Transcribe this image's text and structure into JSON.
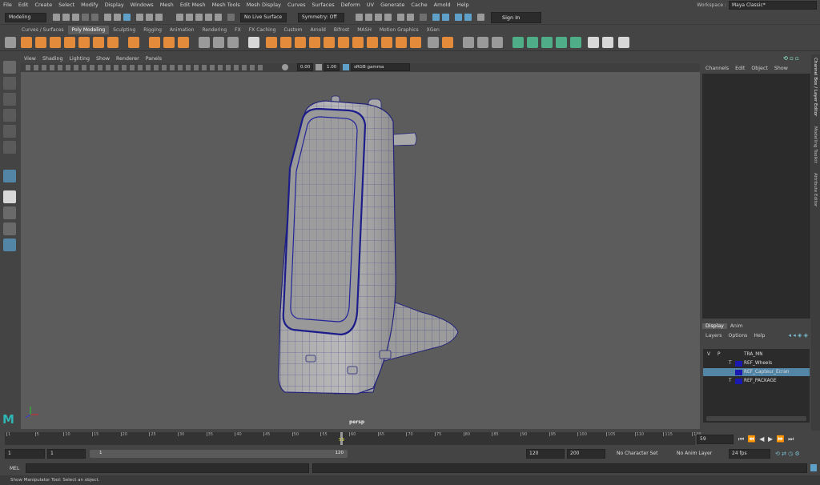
{
  "menubar": {
    "items": [
      "File",
      "Edit",
      "Create",
      "Select",
      "Modify",
      "Display",
      "Windows",
      "Mesh",
      "Edit Mesh",
      "Mesh Tools",
      "Mesh Display",
      "Curves",
      "Surfaces",
      "Deform",
      "UV",
      "Generate",
      "Cache",
      "Arnold",
      "Help"
    ],
    "workspace_label": "Workspace :",
    "workspace_value": "Maya Classic*"
  },
  "statusline": {
    "mode": "Modeling",
    "live_surface": "No Live Surface",
    "symmetry": "Symmetry: Off",
    "sign_in": "Sign In"
  },
  "shelf": {
    "tabs": [
      "Curves / Surfaces",
      "Poly Modeling",
      "Sculpting",
      "Rigging",
      "Animation",
      "Rendering",
      "FX",
      "FX Caching",
      "Custom",
      "Arnold",
      "Bifrost",
      "MASH",
      "Motion Graphics",
      "XGen"
    ],
    "active_tab": "Poly Modeling"
  },
  "viewport": {
    "menu": [
      "View",
      "Shading",
      "Lighting",
      "Show",
      "Renderer",
      "Panels"
    ],
    "exposure": "0.00",
    "gamma": "1.00",
    "color_space": "sRGB gamma",
    "camera": "persp"
  },
  "channelbox": {
    "menu": [
      "Channels",
      "Edit",
      "Object",
      "Show"
    ]
  },
  "side_tabs": [
    "Channel Box / Layer Editor",
    "Modelling Toolkit",
    "Attribute Editor"
  ],
  "layer_editor": {
    "tabs": [
      "Display",
      "Anim"
    ],
    "active_tab": "Display",
    "menu": [
      "Layers",
      "Options",
      "Help"
    ],
    "header": {
      "v": "V",
      "p": "P",
      "name": "TRA_MN"
    },
    "layers": [
      {
        "name": "REF_Wheels",
        "flag": "T",
        "selected": false,
        "color": "#1a1ab0"
      },
      {
        "name": "REF_Capteur_Ecran",
        "flag": "",
        "selected": true,
        "color": "#1a1ab0"
      },
      {
        "name": "REF_PACKAGE",
        "flag": "T",
        "selected": false,
        "color": "#1a1ab0"
      }
    ]
  },
  "timeline": {
    "ticks": [
      "1",
      "5",
      "10",
      "15",
      "20",
      "25",
      "30",
      "35",
      "40",
      "45",
      "50",
      "55",
      "60",
      "65",
      "70",
      "75",
      "80",
      "85",
      "90",
      "95",
      "100",
      "105",
      "110",
      "115",
      "120"
    ],
    "current_frame": "59",
    "current_frame_marker": "59"
  },
  "range": {
    "start": "1",
    "start2": "1",
    "slider_start": "1",
    "slider_end": "120",
    "end": "120",
    "end2": "200",
    "character_set": "No Character Set",
    "anim_layer": "No Anim Layer",
    "fps": "24 fps"
  },
  "cmdline": {
    "label": "MEL"
  },
  "helpline": {
    "text": "Show Manipulator Tool: Select an object."
  },
  "colors": {
    "accent": "#5285a6",
    "shelf_orange": "#e38b3a",
    "shelf_green": "#4fae87",
    "wire": "#22237a"
  }
}
